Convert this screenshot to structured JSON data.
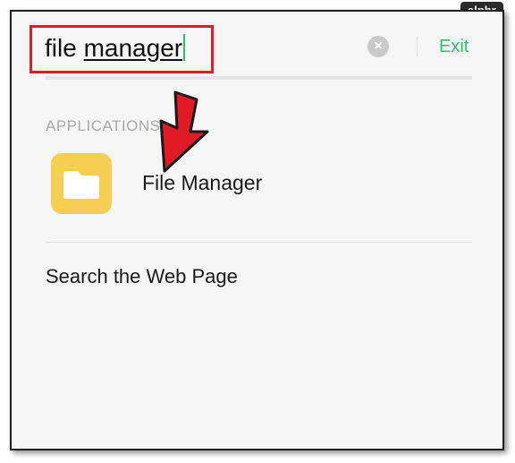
{
  "brand": {
    "text": "alphr"
  },
  "search": {
    "query_word1": "file",
    "query_word2": "manager",
    "clear_icon": "clear-circle-icon",
    "exit_label": "Exit"
  },
  "results": {
    "section_header": "APPLICATIONS",
    "apps": [
      {
        "label": "File Manager",
        "icon": "folder-icon",
        "icon_color": "#f6cf52"
      }
    ],
    "web_search_label": "Search the Web Page"
  },
  "colors": {
    "accent": "#2fbf71",
    "highlight_box": "#e01b24",
    "annotation_arrow": "#e01b24"
  }
}
